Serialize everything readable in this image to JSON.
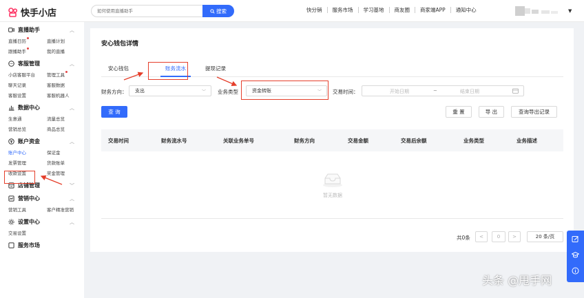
{
  "app": {
    "title": "快手小店"
  },
  "search": {
    "placeholder": "如何使用直播助手",
    "button_label": "搜索"
  },
  "topnav": {
    "items": [
      "快分销",
      "服务市场",
      "学习基地",
      "商友圈",
      "商家端APP",
      "通知中心"
    ]
  },
  "sidebar": {
    "groups": [
      {
        "title": "直播助手",
        "rows": [
          [
            "直播日历",
            "直播计划"
          ],
          [
            "跟播助手",
            "我的直播"
          ]
        ]
      },
      {
        "title": "客服管理",
        "rows": [
          [
            "小店客服平台",
            "管理工具"
          ],
          [
            "聊天记录",
            "客服数据"
          ],
          [
            "客服设置",
            "客服机器人"
          ]
        ]
      },
      {
        "title": "数据中心",
        "rows": [
          [
            "生意通",
            "流量总览"
          ],
          [
            "营销总览",
            "商品总览"
          ]
        ]
      },
      {
        "title": "账户资金",
        "rows": [
          [
            "账户中心",
            "保证金"
          ],
          [
            "发票管理",
            "货款账单"
          ],
          [
            "收款设置",
            "奖金管理"
          ]
        ]
      },
      {
        "title": "店铺管理",
        "rows": []
      },
      {
        "title": "营销中心",
        "rows": [
          [
            "营销工具",
            "客户精准营销"
          ]
        ]
      },
      {
        "title": "设置中心",
        "rows": [
          [
            "交易设置"
          ]
        ]
      },
      {
        "title": "服务市场",
        "rows": []
      }
    ]
  },
  "main": {
    "title": "安心钱包详情",
    "tabs": [
      "安心钱包",
      "账务流水",
      "提现记录"
    ],
    "active_tab": "账务流水",
    "filters": {
      "direction_label": "财务方向：",
      "direction_value": "支出",
      "type_label": "业务类型",
      "type_value": "资金转账",
      "time_label": "交易时间：",
      "start_placeholder": "开始日期",
      "range_sep": "~",
      "end_placeholder": "结束日期"
    },
    "buttons": {
      "query": "查 询",
      "reset": "重 置",
      "export": "导 出",
      "export_records": "查询导出记录"
    },
    "table": {
      "columns": [
        "交易时间",
        "财务流水号",
        "关联业务单号",
        "财务方向",
        "交易金额",
        "交易后余额",
        "业务类型",
        "业务描述"
      ],
      "empty_text": "暂无数据"
    },
    "pagination": {
      "total": "共0条",
      "prev": "<",
      "page": "0",
      "next": ">",
      "page_size": "20 条/页"
    }
  },
  "watermark": "头条 @甩手网",
  "colors": {
    "accent": "#326bfb",
    "annotation": "#e53e2a",
    "badge_dot": "#e54545"
  }
}
